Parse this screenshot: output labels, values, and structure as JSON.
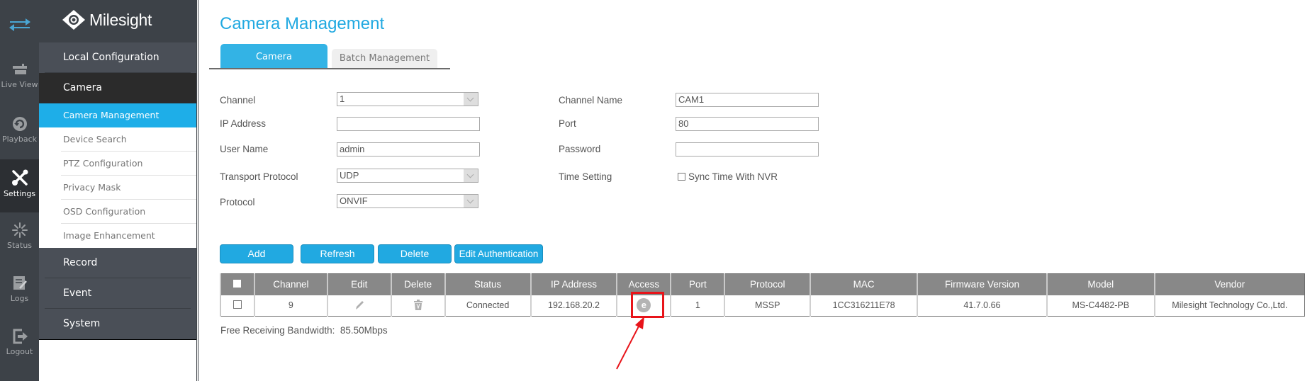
{
  "rail": {
    "items": [
      {
        "label": "Live View",
        "icon": "live-view-icon"
      },
      {
        "label": "Playback",
        "icon": "playback-icon"
      },
      {
        "label": "Settings",
        "icon": "settings-icon",
        "active": true
      },
      {
        "label": "Status",
        "icon": "status-icon"
      },
      {
        "label": "Logs",
        "icon": "logs-icon"
      },
      {
        "label": "Logout",
        "icon": "logout-icon"
      }
    ]
  },
  "brand": {
    "name": "Milesight"
  },
  "menu": {
    "sections": [
      {
        "label": "Local Configuration"
      },
      {
        "label": "Camera",
        "expanded": true,
        "items": [
          {
            "label": "Camera Management",
            "active": true
          },
          {
            "label": "Device Search"
          },
          {
            "label": "PTZ Configuration"
          },
          {
            "label": "Privacy Mask"
          },
          {
            "label": "OSD Configuration"
          },
          {
            "label": "Image Enhancement"
          }
        ]
      },
      {
        "label": "Record"
      },
      {
        "label": "Event"
      },
      {
        "label": "System"
      }
    ]
  },
  "page": {
    "title": "Camera Management",
    "tabs": [
      {
        "label": "Camera Management",
        "active": true
      },
      {
        "label": "Batch Management",
        "active": false
      }
    ]
  },
  "form": {
    "channel": {
      "label": "Channel",
      "value": "1"
    },
    "ip_address": {
      "label": "IP Address",
      "value": ""
    },
    "user_name": {
      "label": "User Name",
      "value": "admin"
    },
    "transport_protocol": {
      "label": "Transport Protocol",
      "value": "UDP"
    },
    "protocol": {
      "label": "Protocol",
      "value": "ONVIF"
    },
    "channel_name": {
      "label": "Channel Name",
      "value": "CAM1"
    },
    "port": {
      "label": "Port",
      "value": "80"
    },
    "password": {
      "label": "Password",
      "value": ""
    },
    "time_setting": {
      "label": "Time Setting",
      "checkbox_label": "Sync Time With NVR",
      "checked": false
    }
  },
  "buttons": {
    "add": "Add",
    "refresh": "Refresh",
    "delete": "Delete",
    "edit_authentication": "Edit Authentication"
  },
  "table": {
    "columns": [
      "",
      "Channel",
      "Edit",
      "Delete",
      "Status",
      "IP Address",
      "Access",
      "Port",
      "Protocol",
      "MAC",
      "Firmware Version",
      "Model",
      "Vendor"
    ],
    "rows": [
      {
        "checked": false,
        "channel": "9",
        "edit_icon": "pencil-icon",
        "delete_icon": "trash-icon",
        "status": "Connected",
        "ip_address": "192.168.20.2",
        "access_icon": "browser-e-icon",
        "port": "1",
        "protocol": "MSSP",
        "mac": "1CC316211E78",
        "firmware_version": "41.7.0.66",
        "model": "MS-C4482-PB",
        "vendor": "Milesight Technology Co.,Ltd."
      }
    ]
  },
  "bandwidth": {
    "label": "Free Receiving Bandwidth:",
    "value": "85.50Mbps"
  },
  "annotation": {
    "highlight_color": "#e8141a",
    "target": "Access"
  },
  "colors": {
    "accent": "#21a9e1",
    "rail_bg": "#3d4248",
    "table_header": "#888888"
  }
}
